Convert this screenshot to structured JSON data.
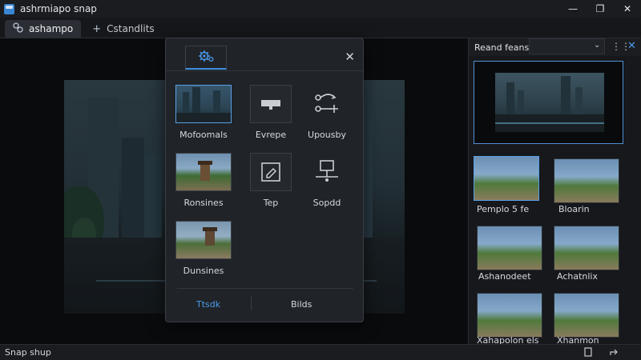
{
  "window": {
    "title": "ashrmiapo snap",
    "minimize": "—",
    "maximize": "❐",
    "close": "✕"
  },
  "tabs": [
    {
      "label": "ashampo",
      "icon": "snap-logo-icon"
    },
    {
      "label": "Cstandlits",
      "icon": "plus-icon",
      "glyph": "+"
    }
  ],
  "dialog": {
    "close": "✕",
    "tiles": [
      {
        "label": "Mofoomals"
      },
      {
        "label": "Evrepe"
      },
      {
        "label": "Upousby"
      },
      {
        "label": "Ronsines"
      },
      {
        "label": "Tep"
      },
      {
        "label": "Sopdd"
      },
      {
        "label": "Dunsines"
      }
    ],
    "footer": {
      "left": "Ttsdk",
      "right": "Bilds"
    },
    "accent": "#3d8fe0"
  },
  "panel": {
    "title": "Reand feans",
    "chevron": "⌄",
    "menu_icon": "⋮⋮",
    "close": "✕",
    "thumbs": [
      {
        "label": "Pemplo 5 fe"
      },
      {
        "label": "Bloarin"
      },
      {
        "label": "Ashanodeet"
      },
      {
        "label": "Achatnlix"
      },
      {
        "label": "Xahapolon els"
      },
      {
        "label": "Xhanmon"
      }
    ]
  },
  "status": {
    "text": "Snap shup"
  }
}
